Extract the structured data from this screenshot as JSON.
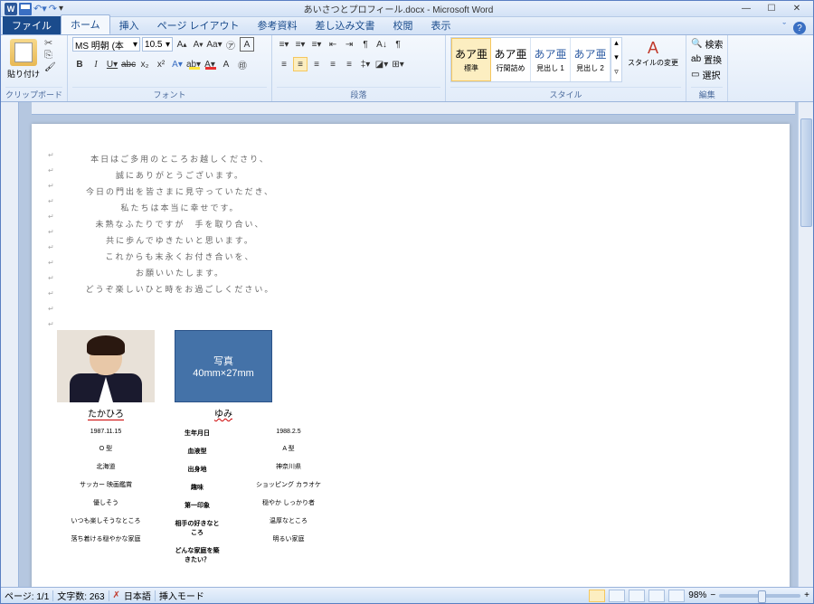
{
  "title": "あいさつとプロフィール.docx - Microsoft Word",
  "tabs": {
    "file": "ファイル",
    "home": "ホーム",
    "insert": "挿入",
    "layout": "ページ レイアウト",
    "ref": "参考資料",
    "mail": "差し込み文書",
    "review": "校閲",
    "view": "表示"
  },
  "ribbon": {
    "clipboard": {
      "label": "クリップボード",
      "paste": "貼り付け"
    },
    "font": {
      "label": "フォント",
      "name": "MS 明朝 (本",
      "size": "10.5",
      "grow": "A",
      "shrink": "A",
      "clear": "Aa",
      "phonetic": "㋐",
      "border": "田",
      "charbg": "A"
    },
    "para": {
      "label": "段落"
    },
    "style": {
      "label": "スタイル",
      "items": [
        {
          "prev": "あア亜",
          "name": "標準"
        },
        {
          "prev": "あア亜",
          "name": "行間詰め"
        },
        {
          "prev": "あア亜",
          "name": "見出し 1"
        },
        {
          "prev": "あア亜",
          "name": "見出し 2"
        }
      ],
      "change": "スタイルの変更"
    },
    "edit": {
      "label": "編集",
      "find": "検索",
      "replace": "置換",
      "select": "選択"
    }
  },
  "doc": {
    "greeting": [
      "本日はご多用のところお越しくださり、",
      "誠にありがとうございます。",
      "今日の門出を皆さまに見守っていただき、",
      "私たちは本当に幸せです。",
      "未熟なふたりですが　手を取り合い、",
      "共に歩んでゆきたいと思います。",
      "これからも末永くお付き合いを、",
      "お願いいたします。",
      "どうぞ楽しいひと時をお過ごしください。"
    ],
    "photo_label_1": "写真",
    "photo_label_2": "40mm×27mm",
    "name1": "たかひろ",
    "name2": "ゆみ",
    "rows": [
      {
        "l": "1987.11.15",
        "m": "生年月日",
        "r": "1988.2.5"
      },
      {
        "l": "O 型",
        "m": "血液型",
        "r": "A 型"
      },
      {
        "l": "北海道",
        "m": "出身地",
        "r": "神奈川県"
      },
      {
        "l": "サッカー 映画鑑賞",
        "m": "趣味",
        "r": "ショッピング カラオケ"
      },
      {
        "l": "優しそう",
        "m": "第一印象",
        "r": "穏やか しっかり者"
      },
      {
        "l": "いつも楽しそうなところ",
        "m": "相手の好きなところ",
        "r": "温厚なところ"
      },
      {
        "l": "落ち着ける穏やかな家庭",
        "m": "どんな家庭を築きたい？",
        "r": "明るい家庭"
      }
    ]
  },
  "status": {
    "page": "ページ: 1/1",
    "words": "文字数: 263",
    "lang": "日本語",
    "mode": "挿入モード",
    "zoom": "98%"
  }
}
